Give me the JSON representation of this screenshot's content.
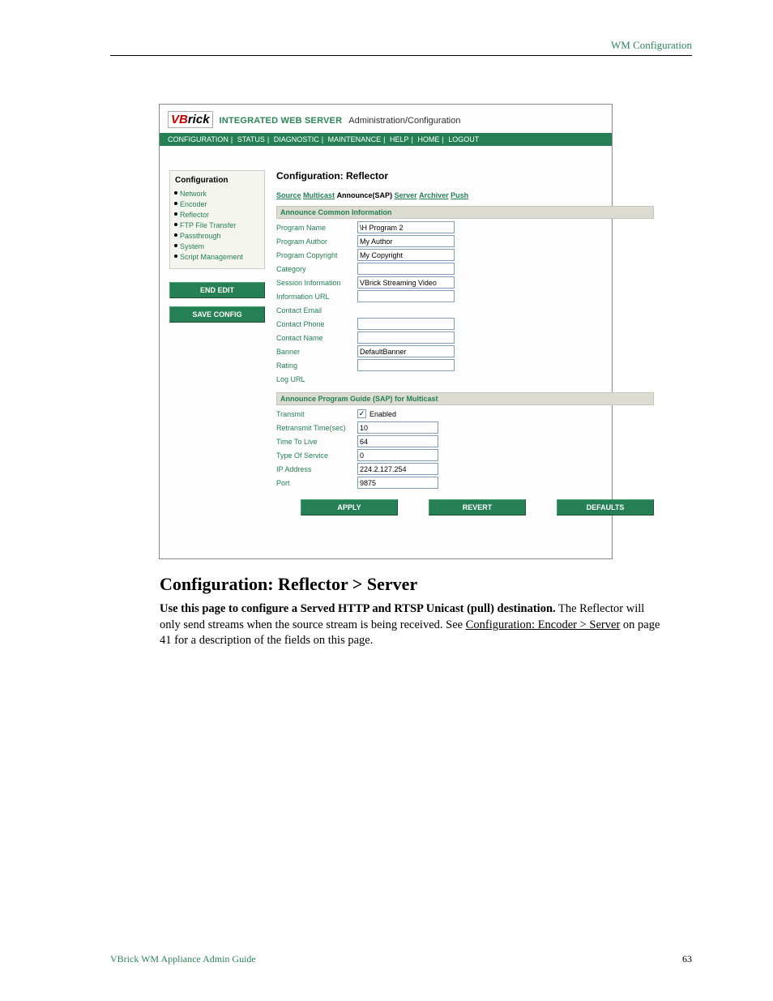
{
  "header": {
    "right": "WM Configuration"
  },
  "footer": {
    "left": "VBrick WM Appliance Admin Guide",
    "right": "63"
  },
  "heading": "Configuration: Reflector > Server",
  "para": {
    "bold": "Use this page to configure a Served HTTP and RTSP Unicast (pull) destination.",
    "rest1": " The Reflector will only send streams when the source stream is being received. See ",
    "link": "Configuration: Encoder > Server",
    "rest2": " on page 41 for a description of the fields on this page."
  },
  "ss": {
    "logo_prefix": "VB",
    "logo_suffix": "rick",
    "iws": "INTEGRATED WEB SERVER",
    "admin": "Administration/Configuration",
    "topnav": [
      "CONFIGURATION",
      "STATUS",
      "DIAGNOSTIC",
      "MAINTENANCE",
      "HELP",
      "HOME",
      "LOGOUT"
    ],
    "side_title": "Configuration",
    "side_items": [
      "Network",
      "Encoder",
      "Reflector",
      "FTP File Transfer",
      "Passthrough",
      "System",
      "Script Management"
    ],
    "btn_end": "END EDIT",
    "btn_save": "SAVE CONFIG",
    "main_title": "Configuration: Reflector",
    "subnav": {
      "a": "Source",
      "b": "Multicast",
      "active": "Announce(SAP)",
      "c": "Server",
      "d": "Archiver",
      "e": "Push"
    },
    "sec1": "Announce Common Information",
    "fields1": [
      {
        "label": "Program Name",
        "value": "\\H Program 2"
      },
      {
        "label": "Program Author",
        "value": "My Author"
      },
      {
        "label": "Program Copyright",
        "value": "My Copyright"
      },
      {
        "label": "Category",
        "value": ""
      },
      {
        "label": "Session Information",
        "value": "VBrick Streaming Video"
      },
      {
        "label": "Information URL",
        "value": ""
      },
      {
        "label": "Contact Email",
        "value": ""
      },
      {
        "label": "Contact Phone",
        "value": ""
      },
      {
        "label": "Contact Name",
        "value": ""
      },
      {
        "label": "Banner",
        "value": "DefaultBanner"
      },
      {
        "label": "Rating",
        "value": ""
      },
      {
        "label": "Log URL",
        "value": ""
      }
    ],
    "sec2": "Announce Program Guide (SAP) for Multicast",
    "transmit_label": "Transmit",
    "transmit_enabled": "Enabled",
    "fields2": [
      {
        "label": "Retransmit Time(sec)",
        "value": "10"
      },
      {
        "label": "Time To Live",
        "value": "64"
      },
      {
        "label": "Type Of Service",
        "value": "0"
      },
      {
        "label": "IP Address",
        "value": "224.2.127.254"
      },
      {
        "label": "Port",
        "value": "9875"
      }
    ],
    "btn_apply": "APPLY",
    "btn_revert": "REVERT",
    "btn_defaults": "DEFAULTS"
  }
}
